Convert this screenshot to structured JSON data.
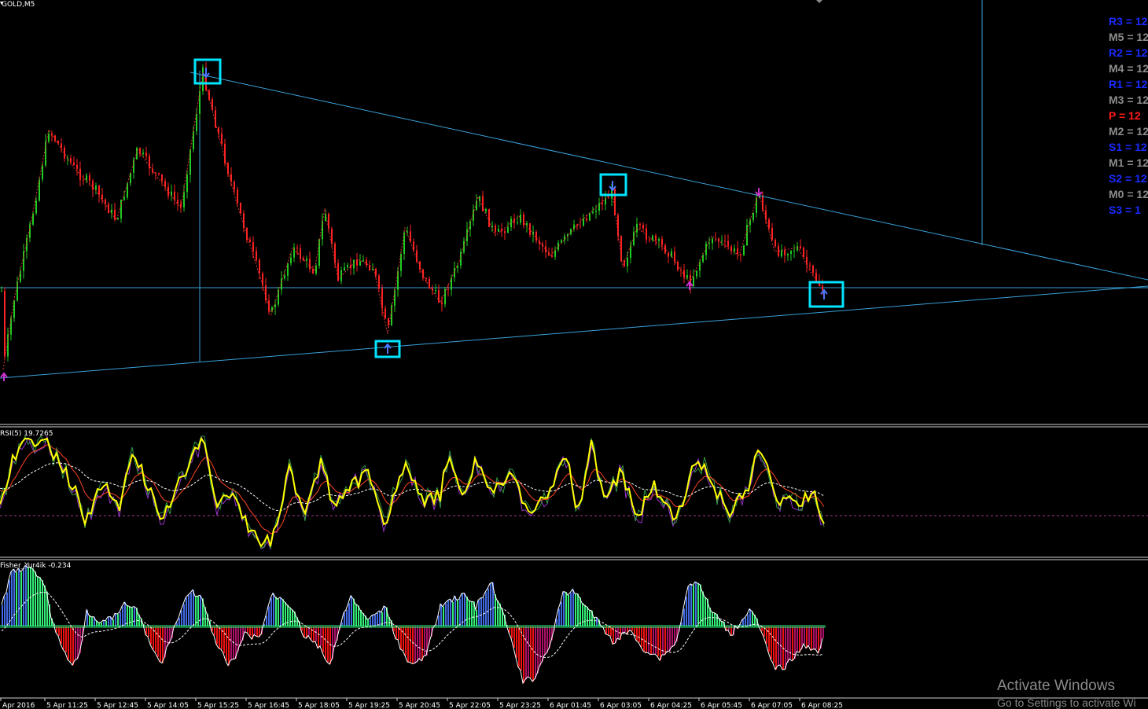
{
  "window": {
    "symbol_label": "GOLD,M5"
  },
  "indicators": {
    "rsi_label": "RSI(5) 19.7265",
    "fisher_label": "Fisher_Yur4ik -0.234"
  },
  "pivot_levels": [
    {
      "label": "R3 = 12",
      "color": "#1a2bff"
    },
    {
      "label": "M5 = 12",
      "color": "#8c8c8c"
    },
    {
      "label": "R2 = 12",
      "color": "#1a2bff"
    },
    {
      "label": "M4 = 12",
      "color": "#8c8c8c"
    },
    {
      "label": "R1 = 12",
      "color": "#1a2bff"
    },
    {
      "label": "M3 = 12",
      "color": "#8c8c8c"
    },
    {
      "label": "P  = 12",
      "color": "#ff1a1a"
    },
    {
      "label": "M2 = 12",
      "color": "#8c8c8c"
    },
    {
      "label": "S1 = 12",
      "color": "#1a2bff"
    },
    {
      "label": "M1 = 12",
      "color": "#8c8c8c"
    },
    {
      "label": "S2 = 12",
      "color": "#1a2bff"
    },
    {
      "label": "M0 = 12",
      "color": "#8c8c8c"
    },
    {
      "label": "S3 = 1",
      "color": "#1a2bff"
    }
  ],
  "time_axis": [
    "Apr 2016",
    "5 Apr 11:25",
    "5 Apr 12:45",
    "5 Apr 14:05",
    "5 Apr 15:25",
    "5 Apr 16:45",
    "5 Apr 18:05",
    "5 Apr 19:25",
    "5 Apr 20:45",
    "5 Apr 22:05",
    "5 Apr 23:25",
    "6 Apr 01:45",
    "6 Apr 03:05",
    "6 Apr 04:25",
    "6 Apr 05:45",
    "6 Apr 07:05",
    "6 Apr 08:25"
  ],
  "watermark": {
    "line1": "Activate Windows",
    "line2": "Go to Settings to activate Wi"
  },
  "colors": {
    "bull_candle": "#22cc22",
    "bear_candle": "#ff2222",
    "trendline": "#3aa0d8",
    "highlight_box": "#00e5ff",
    "rsi_main": "#ffff00",
    "fisher_blue": "#4169e1",
    "fisher_green": "#33ee77",
    "fisher_red": "#ee1111",
    "fisher_maroon": "#aa1166"
  }
}
